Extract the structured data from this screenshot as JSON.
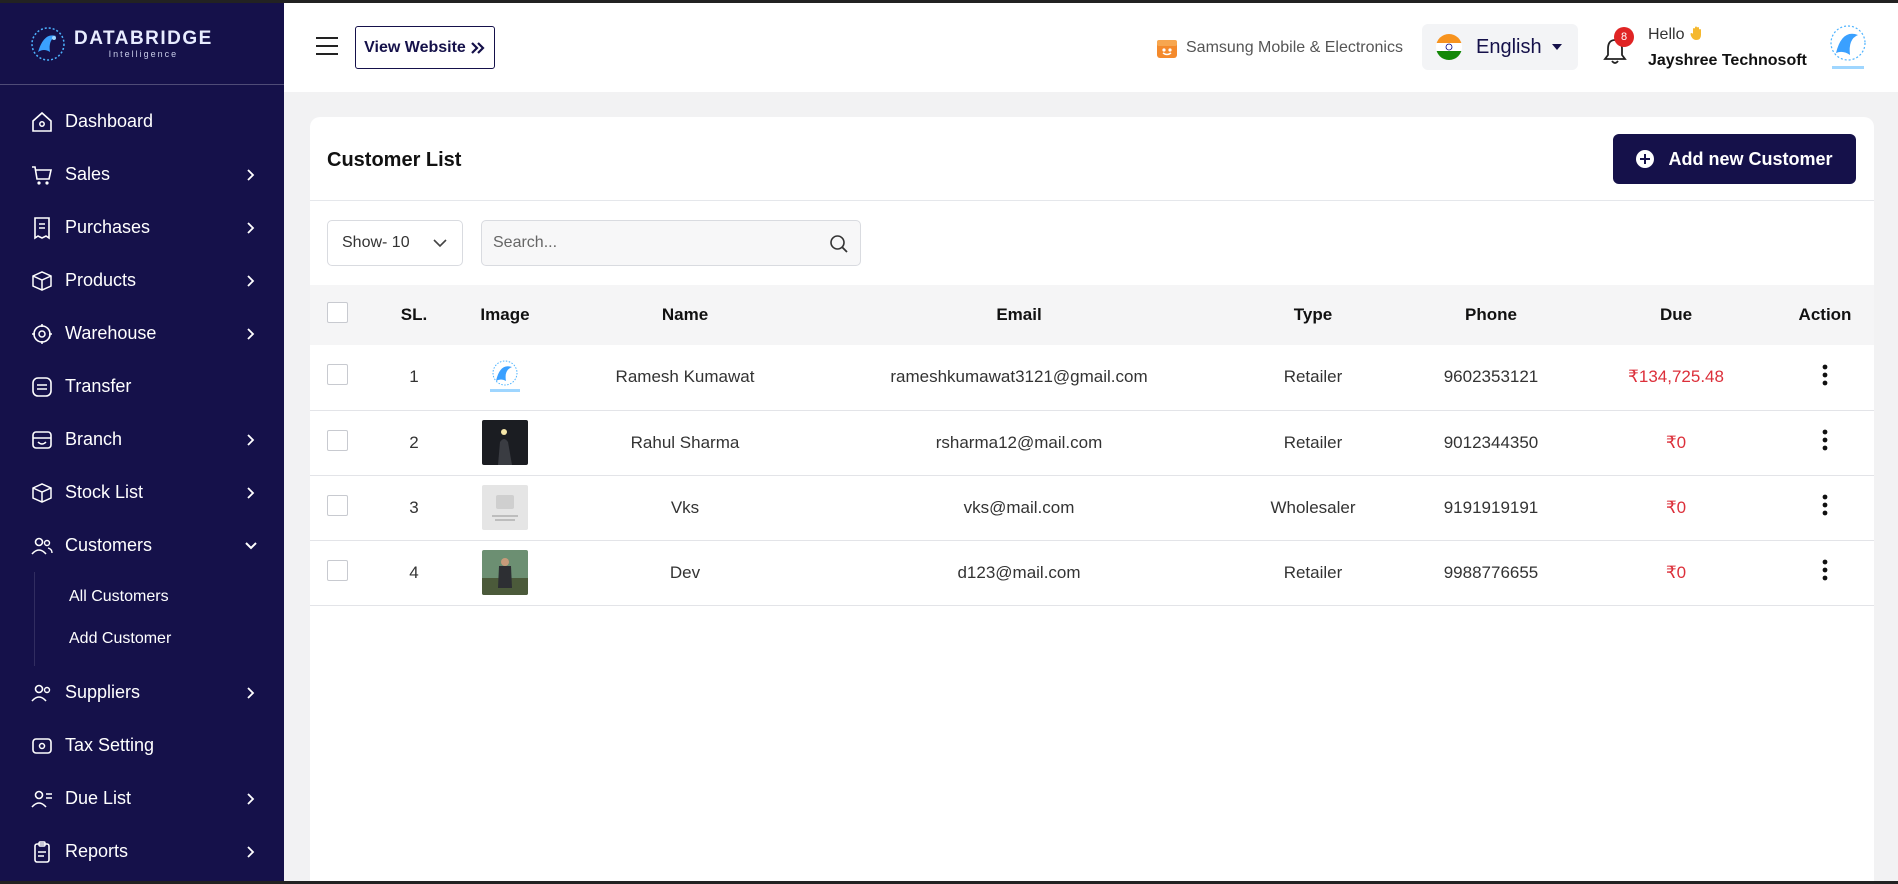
{
  "brand": {
    "name": "DATABRIDGE",
    "sub": "Intelligence"
  },
  "sidebar": {
    "items": [
      {
        "label": "Dashboard",
        "icon": "home-icon",
        "has_children": false
      },
      {
        "label": "Sales",
        "icon": "cart-icon",
        "has_children": true
      },
      {
        "label": "Purchases",
        "icon": "receipt-icon",
        "has_children": true
      },
      {
        "label": "Products",
        "icon": "box-icon",
        "has_children": true
      },
      {
        "label": "Warehouse",
        "icon": "warehouse-icon",
        "has_children": true
      },
      {
        "label": "Transfer",
        "icon": "transfer-icon",
        "has_children": false
      },
      {
        "label": "Branch",
        "icon": "branch-icon",
        "has_children": true
      },
      {
        "label": "Stock List",
        "icon": "stock-icon",
        "has_children": true
      },
      {
        "label": "Customers",
        "icon": "users-icon",
        "has_children": true,
        "expanded": true,
        "children": [
          "All Customers",
          "Add Customer"
        ]
      },
      {
        "label": "Suppliers",
        "icon": "suppliers-icon",
        "has_children": true
      },
      {
        "label": "Tax Setting",
        "icon": "tax-icon",
        "has_children": false
      },
      {
        "label": "Due List",
        "icon": "due-icon",
        "has_children": true
      },
      {
        "label": "Reports",
        "icon": "reports-icon",
        "has_children": true
      }
    ]
  },
  "topbar": {
    "view_website": "View Website",
    "store": "Samsung Mobile & Electronics",
    "language": "English",
    "notifications": "8",
    "hello": "Hello",
    "user": "Jayshree Technosoft"
  },
  "page": {
    "title": "Customer List",
    "add_button": "Add new Customer",
    "show": "Show- 10",
    "search_placeholder": "Search..."
  },
  "table": {
    "headers": [
      "SL.",
      "Image",
      "Name",
      "Email",
      "Type",
      "Phone",
      "Due",
      "Action"
    ],
    "rows": [
      {
        "sl": "1",
        "image": "logo",
        "name": "Ramesh Kumawat",
        "email": "rameshkumawat3121@gmail.com",
        "type": "Retailer",
        "phone": "9602353121",
        "due": "₹134,725.48"
      },
      {
        "sl": "2",
        "image": "night",
        "name": "Rahul Sharma",
        "email": "rsharma12@mail.com",
        "type": "Retailer",
        "phone": "9012344350",
        "due": "₹0"
      },
      {
        "sl": "3",
        "image": "placeholder",
        "name": "Vks",
        "email": "vks@mail.com",
        "type": "Wholesaler",
        "phone": "9191919191",
        "due": "₹0"
      },
      {
        "sl": "4",
        "image": "person",
        "name": "Dev",
        "email": "d123@mail.com",
        "type": "Retailer",
        "phone": "9988776655",
        "due": "₹0"
      }
    ]
  },
  "colors": {
    "primary": "#15114a",
    "due": "#dc2f3a",
    "badge": "#e02424"
  }
}
